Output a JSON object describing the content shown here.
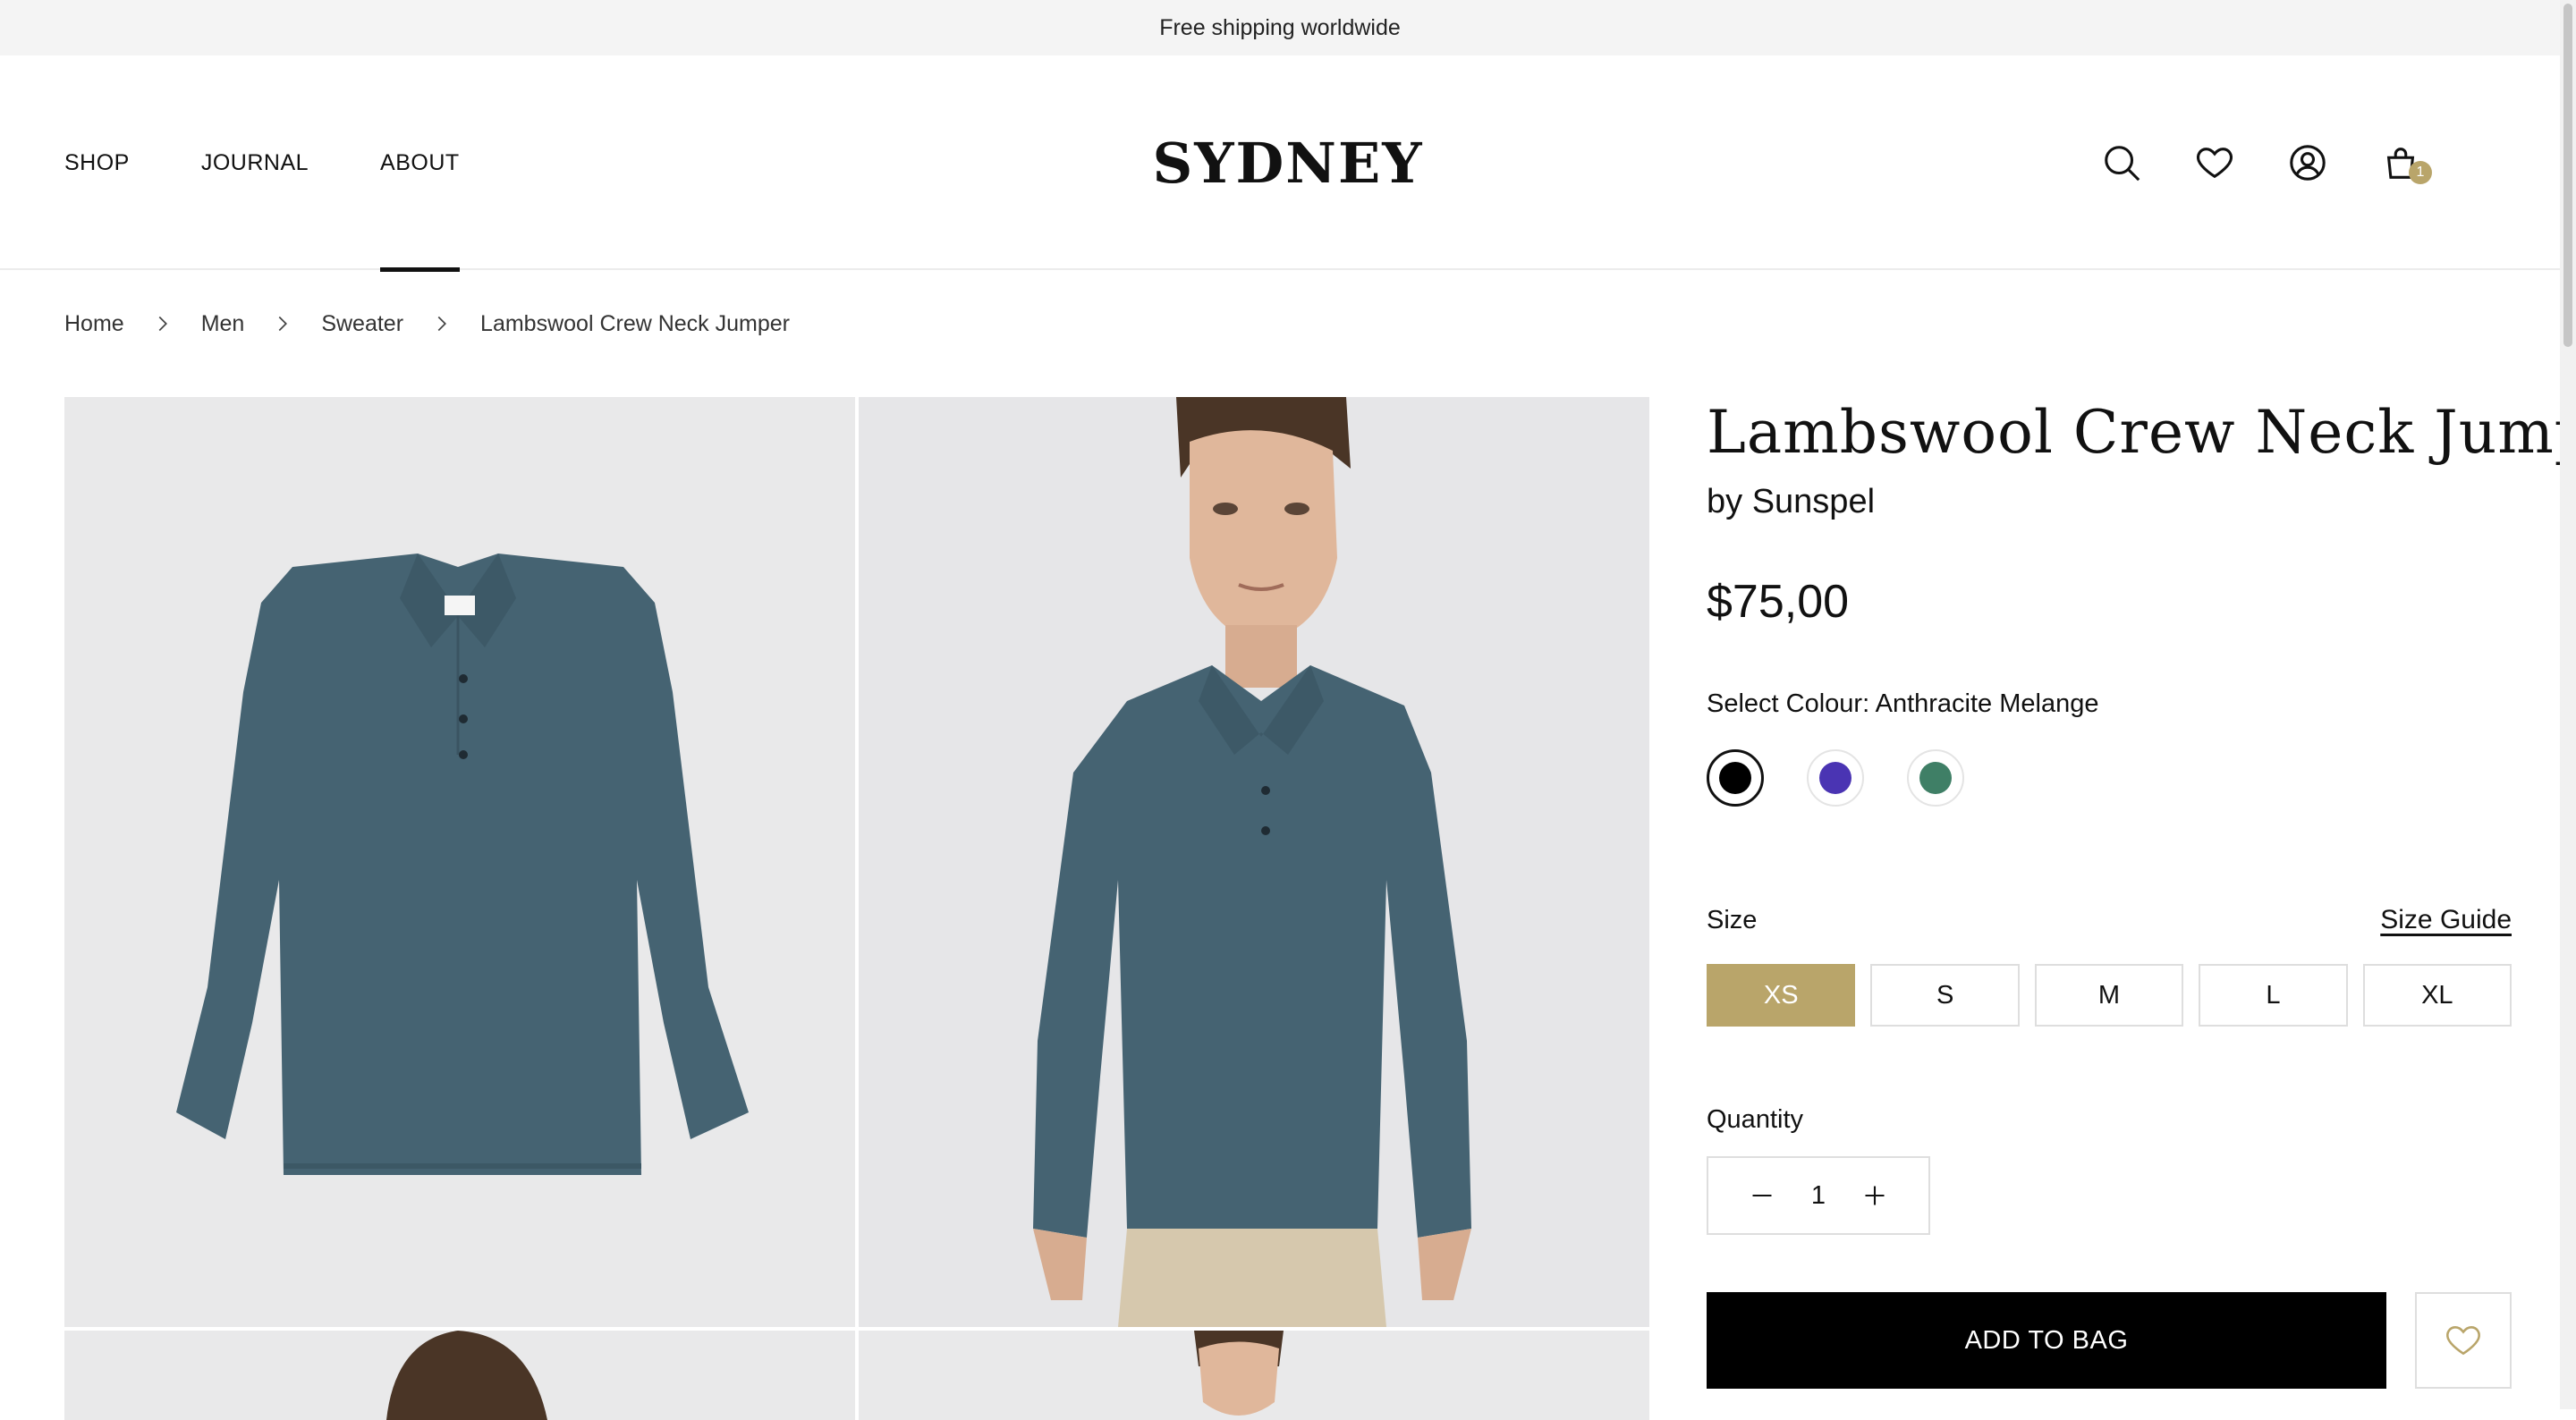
{
  "announcement": "Free shipping worldwide",
  "nav": {
    "items": [
      {
        "label": "SHOP"
      },
      {
        "label": "JOURNAL"
      },
      {
        "label": "ABOUT"
      }
    ],
    "active_index": 2
  },
  "logo": "SYDNEY",
  "header_icons": [
    "search-icon",
    "heart-icon",
    "user-icon",
    "bag-icon"
  ],
  "cart": {
    "count": "1"
  },
  "breadcrumb": [
    "Home",
    "Men",
    "Sweater",
    "Lambswool Crew Neck Jumper"
  ],
  "product": {
    "title": "Lambswool Crew Neck Jumper",
    "brand": "by Sunspel",
    "price": "$75,00",
    "colour_label": "Select Colour: Anthracite Melange",
    "colours": [
      {
        "name": "black",
        "hex": "#000000",
        "selected": true
      },
      {
        "name": "purple",
        "hex": "#4a34b3",
        "selected": false
      },
      {
        "name": "green",
        "hex": "#3f7f66",
        "selected": false
      }
    ],
    "size_label": "Size",
    "size_guide": "Size Guide",
    "sizes": [
      "XS",
      "S",
      "M",
      "L",
      "XL"
    ],
    "selected_size": "XS",
    "quantity_label": "Quantity",
    "quantity": "1",
    "add_to_bag": "ADD TO BAG"
  },
  "colors": {
    "accent": "#b9a56a",
    "sweater": "#456372",
    "image_bg": "#e9e9ea"
  }
}
